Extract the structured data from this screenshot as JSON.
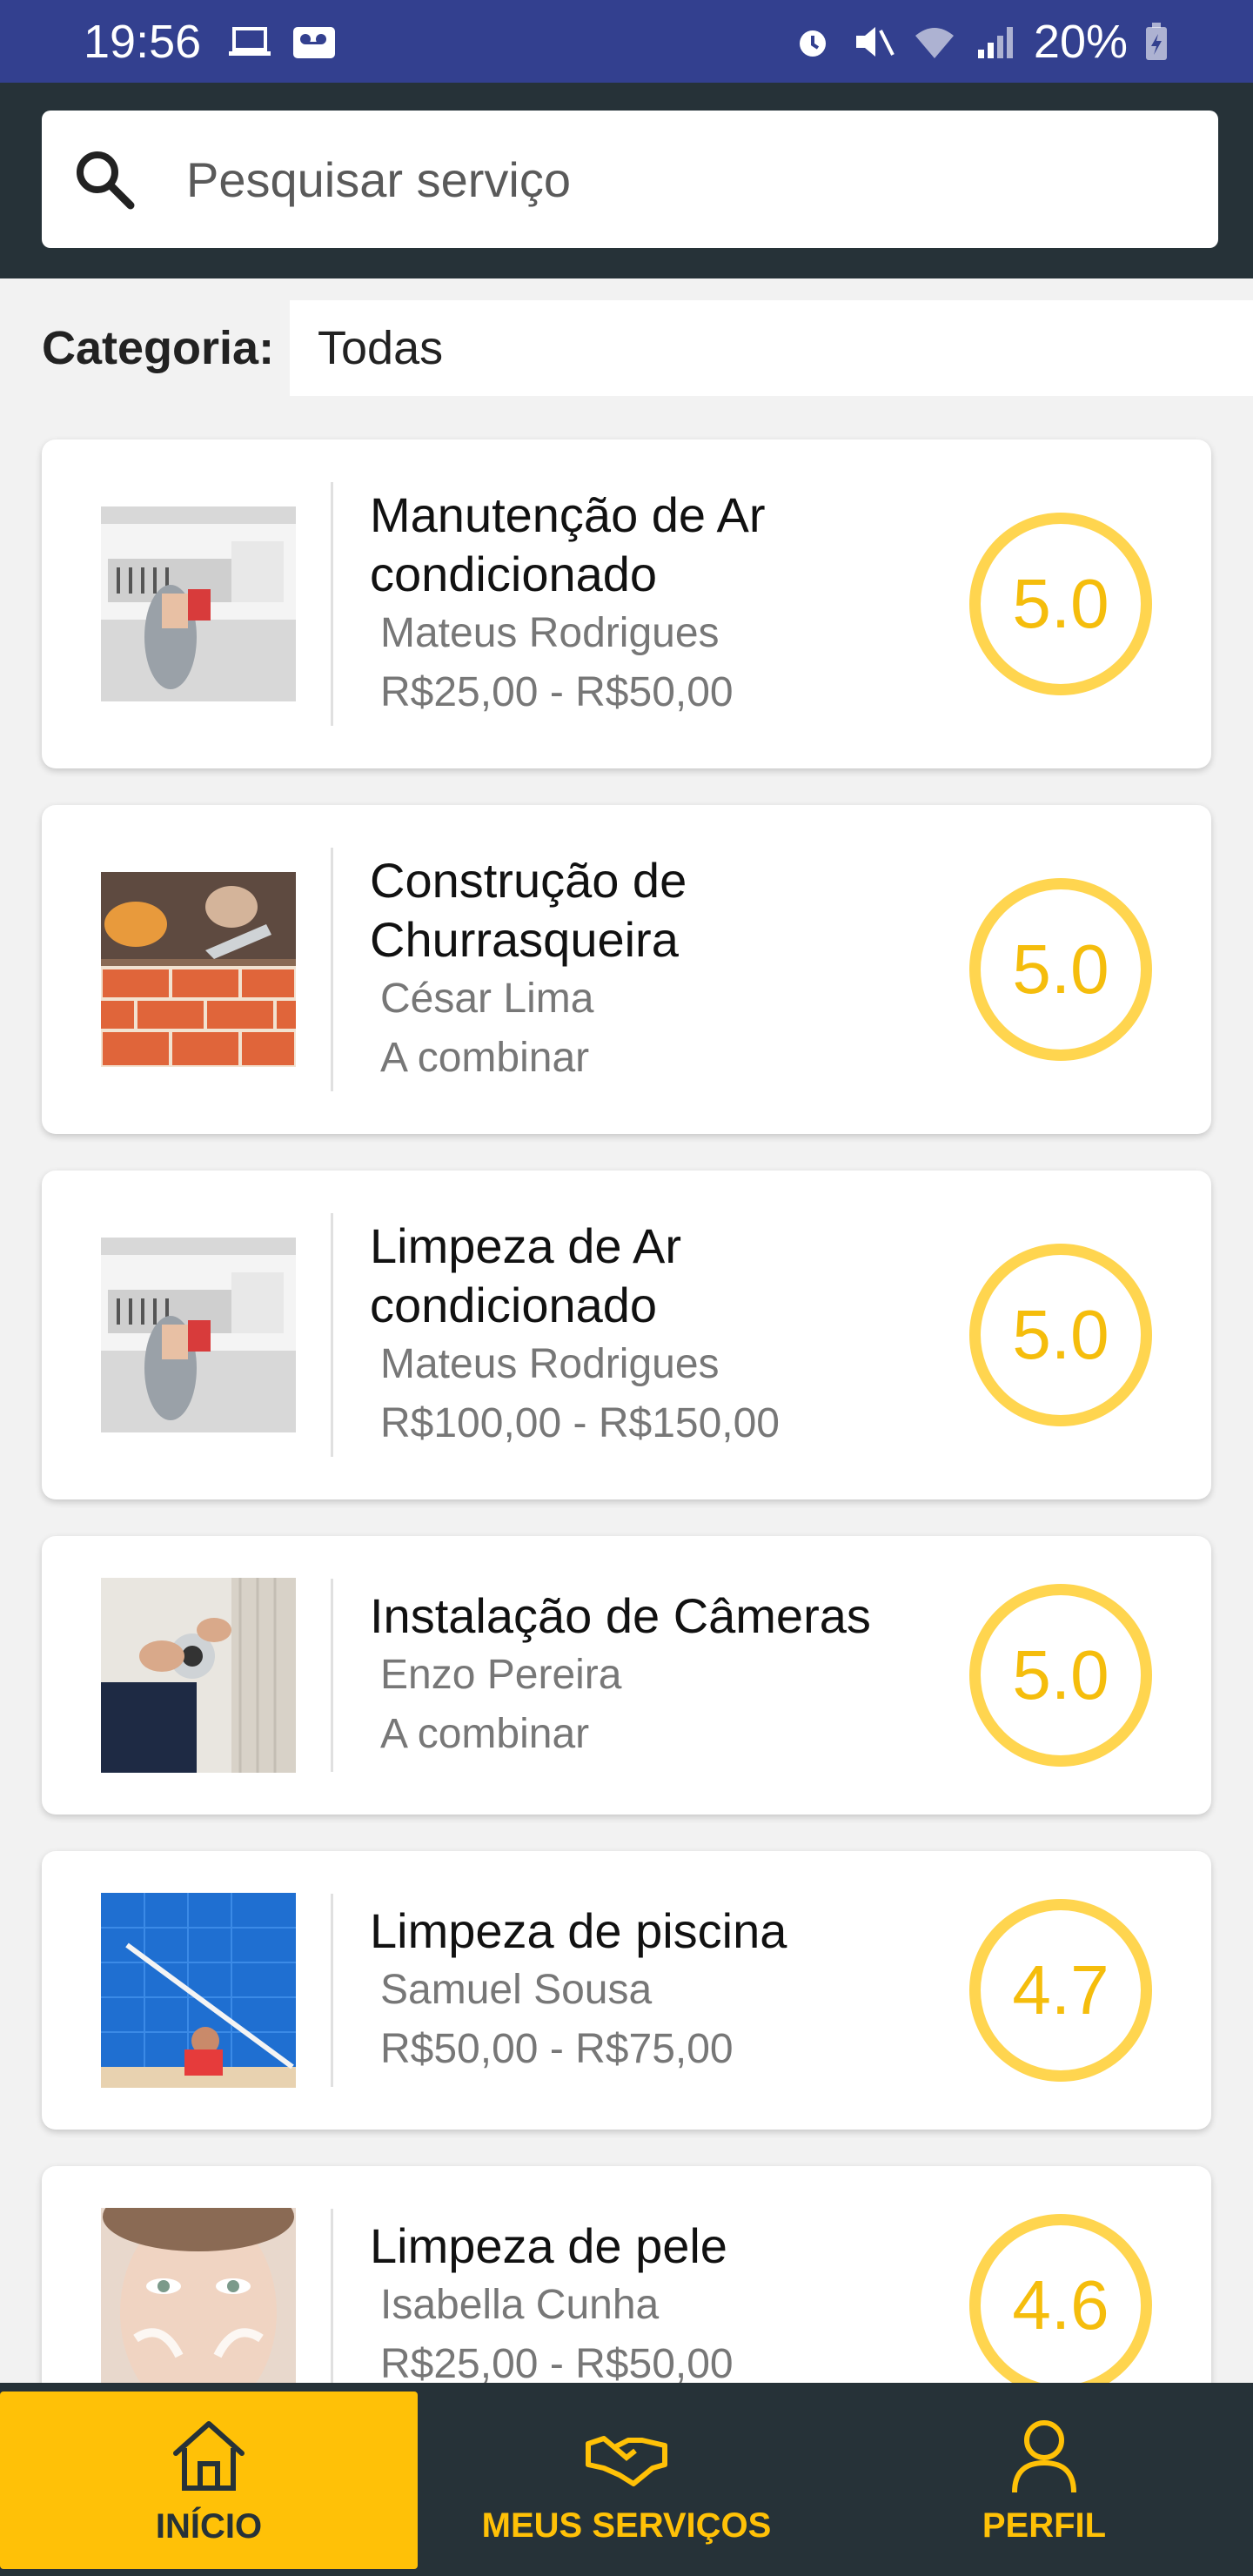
{
  "status_bar": {
    "time": "19:56",
    "battery": "20%"
  },
  "search": {
    "placeholder": "Pesquisar serviço"
  },
  "category": {
    "label": "Categoria:",
    "value": "Todas"
  },
  "services": [
    {
      "title": "Manutenção de Ar condicionado",
      "provider": "Mateus Rodrigues",
      "price": "R$25,00 - R$50,00",
      "rating": "5.0",
      "image": "air-conditioner"
    },
    {
      "title": "Construção de Churrasqueira",
      "provider": "César Lima",
      "price": "A combinar",
      "rating": "5.0",
      "image": "bricks"
    },
    {
      "title": "Limpeza de Ar condicionado",
      "provider": "Mateus Rodrigues",
      "price": "R$100,00 - R$150,00",
      "rating": "5.0",
      "image": "air-conditioner"
    },
    {
      "title": "Instalação de Câmeras",
      "provider": "Enzo Pereira",
      "price": "A combinar",
      "rating": "5.0",
      "image": "camera"
    },
    {
      "title": "Limpeza de piscina",
      "provider": "Samuel Sousa",
      "price": "R$50,00 - R$75,00",
      "rating": "4.7",
      "image": "pool"
    },
    {
      "title": "Limpeza de pele",
      "provider": "Isabella Cunha",
      "price": "R$25,00 - R$50,00",
      "rating": "4.6",
      "image": "face"
    }
  ],
  "nav": [
    {
      "label": "INÍCIO",
      "icon": "home-icon",
      "active": true
    },
    {
      "label": "MEUS SERVIÇOS",
      "icon": "handshake-icon",
      "active": false
    },
    {
      "label": "PERFIL",
      "icon": "person-icon",
      "active": false
    }
  ],
  "colors": {
    "primary": "#263238",
    "accent": "#ffc107",
    "rating": "#ffd54f",
    "status_bar": "#33408f"
  }
}
